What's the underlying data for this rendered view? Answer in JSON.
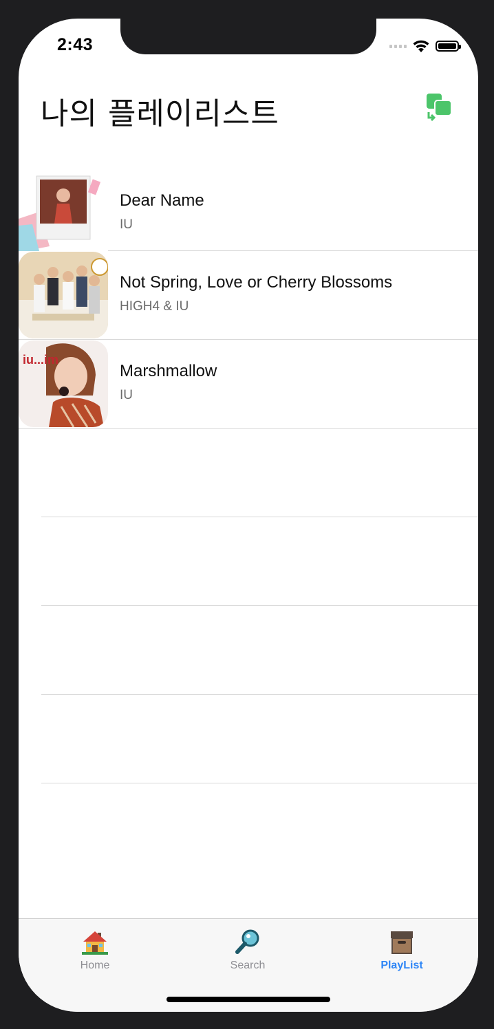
{
  "status": {
    "time": "2:43"
  },
  "header": {
    "title": "나의 플레이리스트",
    "action_icon": "share-copy-icon"
  },
  "songs": [
    {
      "title": "Dear Name",
      "artist": "IU"
    },
    {
      "title": "Not Spring, Love or Cherry Blossoms",
      "artist": "HIGH4 & IU"
    },
    {
      "title": "Marshmallow",
      "artist": "IU"
    }
  ],
  "tabs": [
    {
      "label": "Home",
      "icon": "house-icon",
      "active": false
    },
    {
      "label": "Search",
      "icon": "magnifier-icon",
      "active": false
    },
    {
      "label": "PlayList",
      "icon": "archive-box-icon",
      "active": true
    }
  ],
  "colors": {
    "accent": "#2f86f6",
    "action_green": "#4cc56a"
  }
}
